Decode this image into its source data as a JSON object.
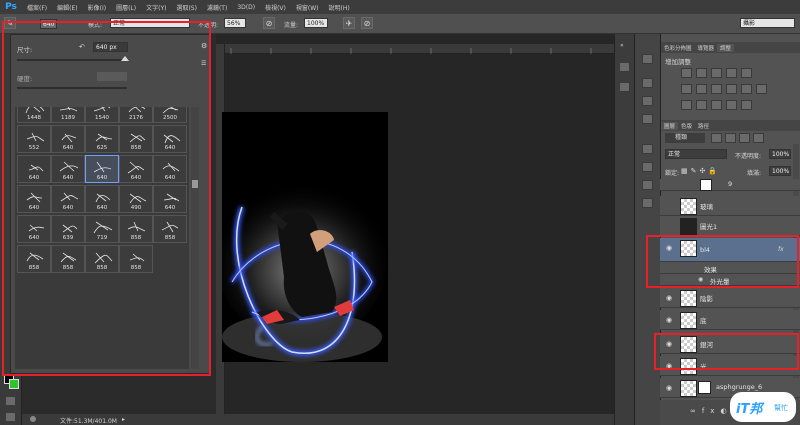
{
  "app": {
    "logo": "Ps"
  },
  "menu": [
    "檔案(F)",
    "編輯(E)",
    "影像(I)",
    "圖層(L)",
    "文字(Y)",
    "選取(S)",
    "濾鏡(T)",
    "3D(D)",
    "檢視(V)",
    "視窗(W)",
    "說明(H)"
  ],
  "options": {
    "brush_size": "640",
    "mode_label": "模式:",
    "mode_value": "正常",
    "opacity_label": "不透明:",
    "opacity_value": "56%",
    "flow_label": "流量:",
    "flow_value": "100%",
    "workspace": "攝影"
  },
  "brush_panel": {
    "size_label": "尺寸:",
    "size_value": "640 px",
    "hardness_label": "硬度:",
    "presets": [
      "1448",
      "1189",
      "1540",
      "2176",
      "2500",
      "552",
      "640",
      "625",
      "858",
      "640",
      "640",
      "640",
      "640",
      "640",
      "640",
      "640",
      "640",
      "640",
      "490",
      "640",
      "640",
      "639",
      "719",
      "858",
      "858",
      "858",
      "858",
      "858",
      "858"
    ]
  },
  "status": {
    "file_info": "文件:51.3M/401.0M"
  },
  "right_panel": {
    "top_tabs": [
      "色彩分佈圖",
      "導覽器",
      "調整"
    ],
    "adjust_title": "增加調整",
    "layer_tabs": [
      "圖層",
      "色版",
      "路徑"
    ],
    "kind_filter": "種類",
    "blend_mode": "正常",
    "opacity_label": "不透明度:",
    "opacity_value": "100%",
    "lock_label": "鎖定:",
    "fill_label": "填滿:",
    "fill_value": "100%",
    "layers": [
      {
        "name": "9"
      },
      {
        "name": "玻璃"
      },
      {
        "name": "圖光1"
      },
      {
        "name": "bl4",
        "fx": "fx"
      },
      {
        "name": "效果"
      },
      {
        "name": "外光暈"
      },
      {
        "name": "陰影"
      },
      {
        "name": "底"
      },
      {
        "name": "銀河"
      },
      {
        "name": "光"
      },
      {
        "name": "asphgrunge_6"
      }
    ]
  },
  "watermark": {
    "brand": "iT邦",
    "sub": "幫忙"
  },
  "colors": {
    "accent_red": "#e8202a",
    "ps_blue": "#31a8ff",
    "selected_layer": "#5b6f8e",
    "glow_blue": "#3a5cff"
  }
}
